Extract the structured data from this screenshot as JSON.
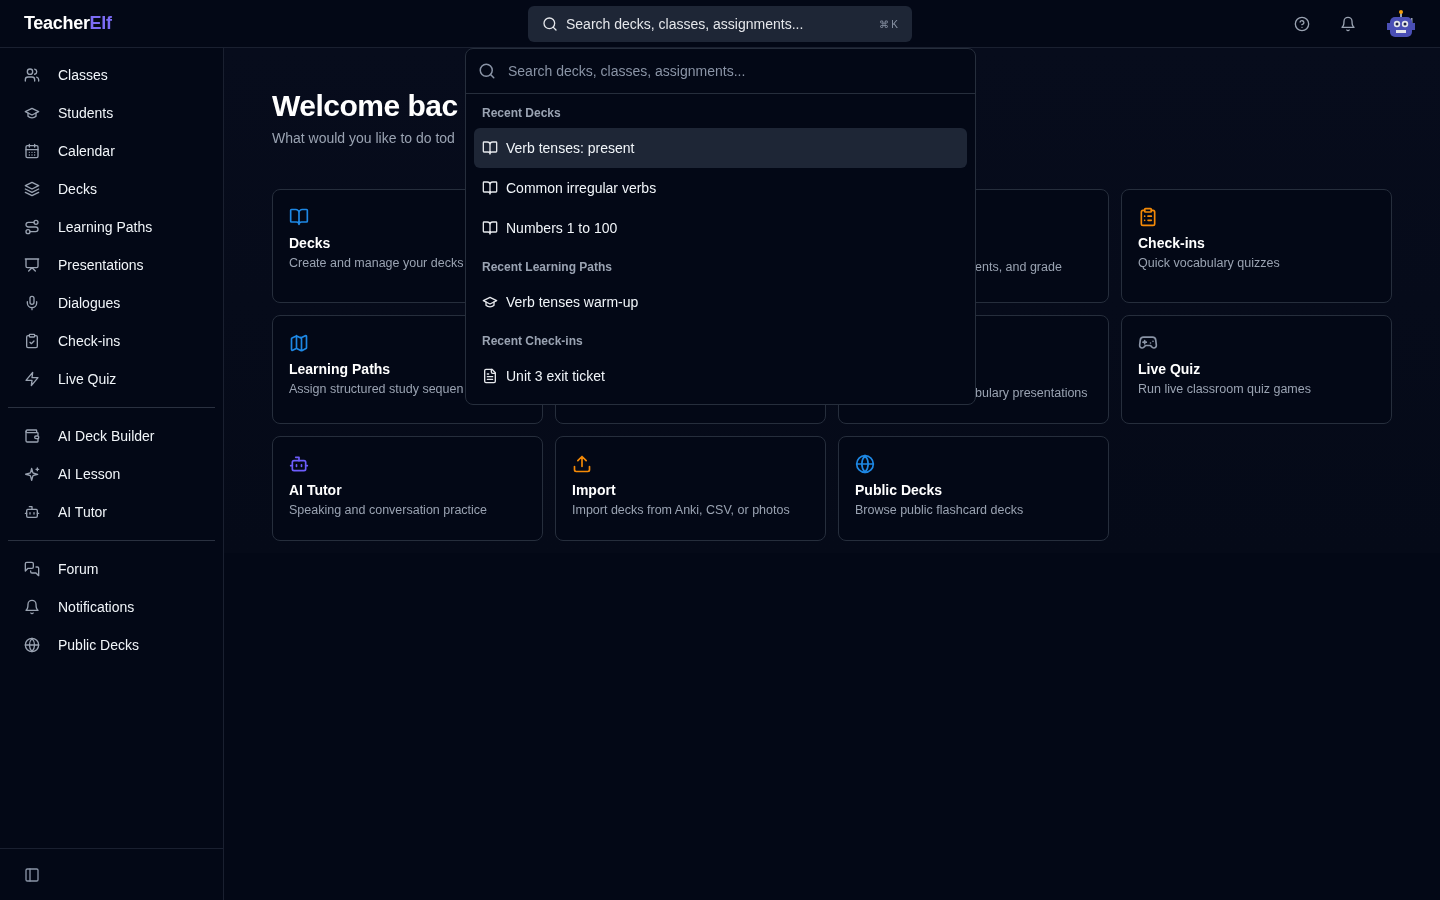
{
  "brand": {
    "name": "Teacher",
    "accent": "Elf"
  },
  "search": {
    "placeholder": "Search decks, classes, assignments...",
    "shortcut_symbol": "⌘",
    "shortcut_key": "K"
  },
  "sidebar": {
    "groups": [
      [
        {
          "label": "Classes"
        },
        {
          "label": "Students"
        },
        {
          "label": "Calendar"
        },
        {
          "label": "Decks"
        },
        {
          "label": "Learning Paths"
        },
        {
          "label": "Presentations"
        },
        {
          "label": "Dialogues"
        },
        {
          "label": "Check-ins"
        },
        {
          "label": "Live Quiz"
        }
      ],
      [
        {
          "label": "AI Deck Builder"
        },
        {
          "label": "AI Lesson"
        },
        {
          "label": "AI Tutor"
        }
      ],
      [
        {
          "label": "Forum"
        },
        {
          "label": "Notifications"
        },
        {
          "label": "Public Decks"
        }
      ]
    ]
  },
  "welcome": {
    "title": "Welcome bac",
    "subtitle": "What would you like to do tod"
  },
  "cards": [
    {
      "kind": "right_covered",
      "title": "Decks",
      "description": "Create and manage your decks",
      "color": "#1e88e5"
    },
    {
      "kind": "hidden"
    },
    {
      "kind": "left_covered",
      "description": "ents, and grade"
    },
    {
      "kind": "full",
      "title": "Check-ins",
      "description": "Quick vocabulary quizzes",
      "color": "#f58a07"
    },
    {
      "kind": "right_covered",
      "title": "Learning Paths",
      "description": "Assign structured study sequen",
      "color": "#1e88e5"
    },
    {
      "kind": "covered"
    },
    {
      "kind": "left_covered",
      "description": "bulary presentations"
    },
    {
      "kind": "full",
      "title": "Live Quiz",
      "description": "Run live classroom quiz games",
      "color": "#8a94a6"
    },
    {
      "kind": "full",
      "title": "AI Tutor",
      "description": "Speaking and conversation practice",
      "color": "#6d5dfc"
    },
    {
      "kind": "full",
      "title": "Import",
      "description": "Import decks from Anki, CSV, or photos",
      "color": "#f58a07"
    },
    {
      "kind": "full",
      "title": "Public Decks",
      "description": "Browse public flashcard decks",
      "color": "#1e88e5"
    }
  ],
  "command_palette": {
    "placeholder": "Search decks, classes, assignments...",
    "sections": [
      {
        "label": "Recent Decks",
        "items": [
          {
            "label": "Verb tenses: present",
            "selected": true
          },
          {
            "label": "Common irregular verbs",
            "selected": false
          },
          {
            "label": "Numbers 1 to 100",
            "selected": false
          }
        ]
      },
      {
        "label": "Recent Learning Paths",
        "items": [
          {
            "label": "Verb tenses warm-up",
            "selected": false
          }
        ]
      },
      {
        "label": "Recent Check-ins",
        "items": [
          {
            "label": "Unit 3 exit ticket",
            "selected": false
          }
        ]
      }
    ]
  }
}
